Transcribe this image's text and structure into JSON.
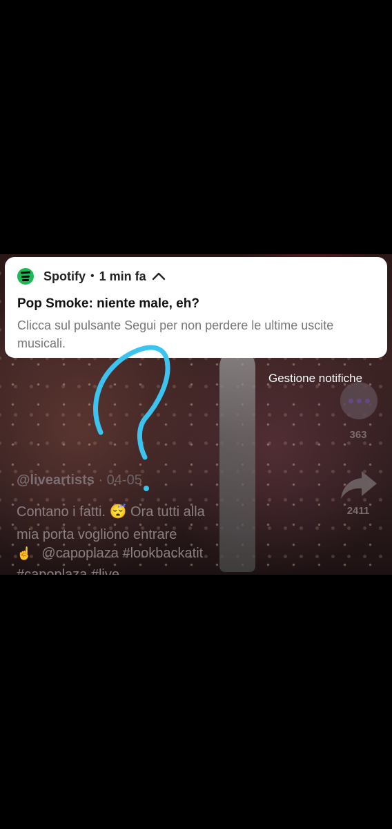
{
  "notification": {
    "app_name": "Spotify",
    "separator": "•",
    "time": "1 min fa",
    "title": "Pop Smoke: niente male, eh?",
    "body": "Clicca sul pulsante Segui per non perdere le ultime uscite musicali.",
    "accent_color": "#1DB954"
  },
  "manage_label": "Gestione notifiche",
  "sidebar": {
    "comment_count": "363",
    "share_count": "2411"
  },
  "post": {
    "author": "@liveartists",
    "date": "· 04-05",
    "caption_line1": "Contano i fatti. 😴 Ora tutti alla",
    "caption_line2": "mia porta vogliono entrare",
    "caption_line3": "@capoplaza #lookbackatit",
    "caption_line4": "#capoplaza #live"
  },
  "icons": {
    "app": "spotify-icon",
    "collapse": "chevron-up-icon",
    "comment": "comment-icon",
    "share": "share-icon",
    "emoji": "pointing-hand-icon"
  },
  "annotation_color": "#3cc3f0"
}
